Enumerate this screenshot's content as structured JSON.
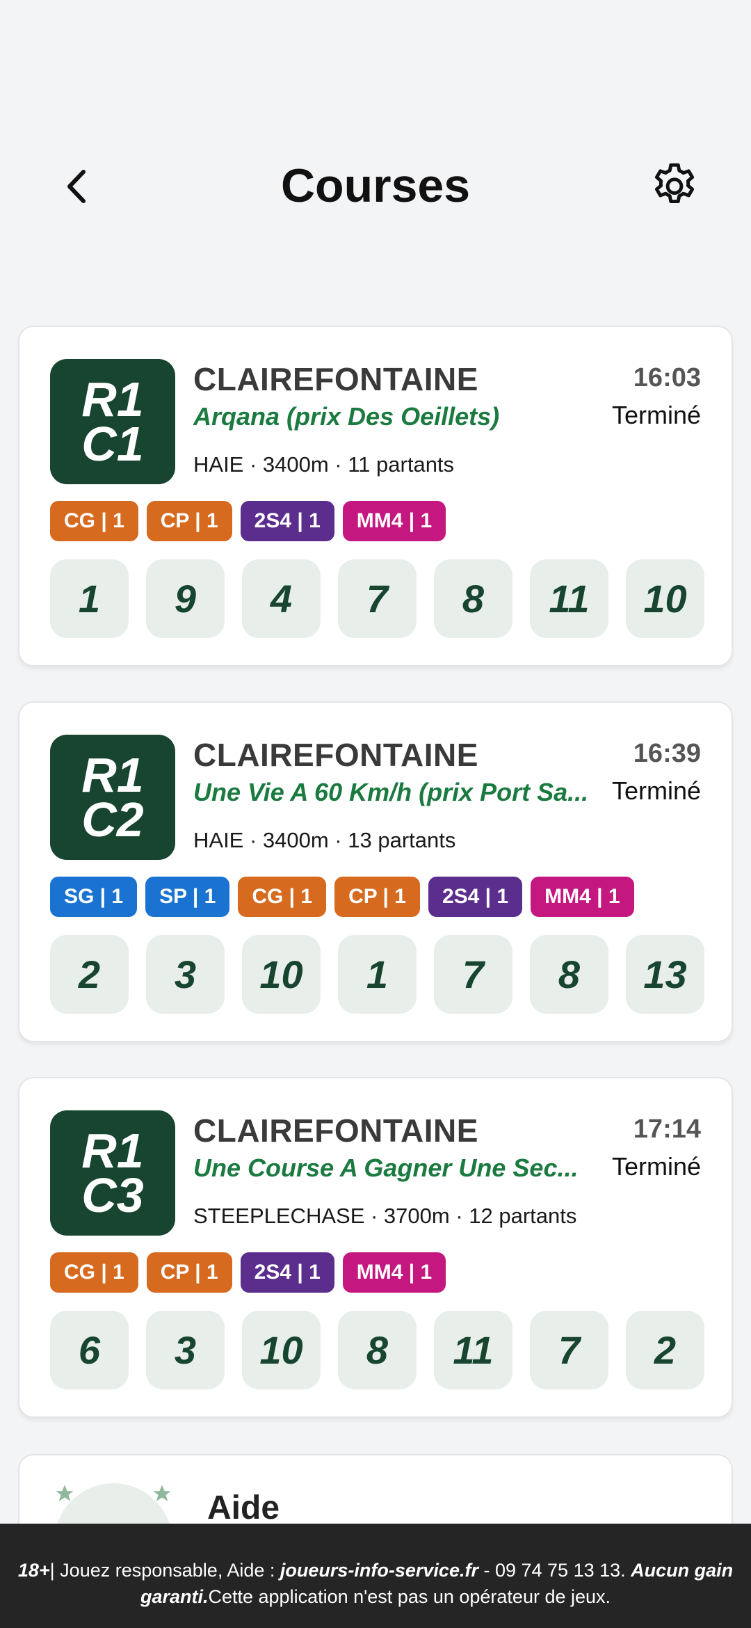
{
  "header": {
    "title": "Courses"
  },
  "races": [
    {
      "badge_line1": "R1",
      "badge_line2": "C1",
      "venue": "CLAIREFONTAINE",
      "name": "Arqana (prix Des Oeillets)",
      "info": "HAIE · 3400m · 11 partants",
      "time": "16:03",
      "status": "Terminé",
      "tags": [
        {
          "label": "CG | 1",
          "color": "#d66a1f"
        },
        {
          "label": "CP | 1",
          "color": "#d66a1f"
        },
        {
          "label": "2S4 | 1",
          "color": "#5b2d8c"
        },
        {
          "label": "MM4 | 1",
          "color": "#c4177f"
        }
      ],
      "numbers": [
        "1",
        "9",
        "4",
        "7",
        "8",
        "11",
        "10"
      ]
    },
    {
      "badge_line1": "R1",
      "badge_line2": "C2",
      "venue": "CLAIREFONTAINE",
      "name": "Une Vie A 60 Km/h (prix Port Sa...",
      "info": "HAIE · 3400m · 13 partants",
      "time": "16:39",
      "status": "Terminé",
      "tags": [
        {
          "label": "SG | 1",
          "color": "#1a73d1"
        },
        {
          "label": "SP | 1",
          "color": "#1a73d1"
        },
        {
          "label": "CG | 1",
          "color": "#d66a1f"
        },
        {
          "label": "CP | 1",
          "color": "#d66a1f"
        },
        {
          "label": "2S4 | 1",
          "color": "#5b2d8c"
        },
        {
          "label": "MM4 | 1",
          "color": "#c4177f"
        }
      ],
      "numbers": [
        "2",
        "3",
        "10",
        "1",
        "7",
        "8",
        "13"
      ]
    },
    {
      "badge_line1": "R1",
      "badge_line2": "C3",
      "venue": "CLAIREFONTAINE",
      "name": "Une Course A Gagner Une Sec...",
      "info": "STEEPLECHASE · 3700m · 12 partants",
      "time": "17:14",
      "status": "Terminé",
      "tags": [
        {
          "label": "CG | 1",
          "color": "#d66a1f"
        },
        {
          "label": "CP | 1",
          "color": "#d66a1f"
        },
        {
          "label": "2S4 | 1",
          "color": "#5b2d8c"
        },
        {
          "label": "MM4 | 1",
          "color": "#c4177f"
        }
      ],
      "numbers": [
        "6",
        "3",
        "10",
        "8",
        "11",
        "7",
        "2"
      ]
    }
  ],
  "help": {
    "title": "Aide"
  },
  "footer": {
    "age": "18+",
    "text1": "| Jouez responsable, Aide : ",
    "site": "joueurs-info-service.fr",
    "text2": " - 09 74 75 13 13. ",
    "bold2": "Aucun gain garanti.",
    "text3": "Cette application n'est pas un opérateur de jeux."
  },
  "colors": {
    "badge": "#174530",
    "accent_green": "#1b7a3f",
    "number_bg": "#e8eeea"
  }
}
